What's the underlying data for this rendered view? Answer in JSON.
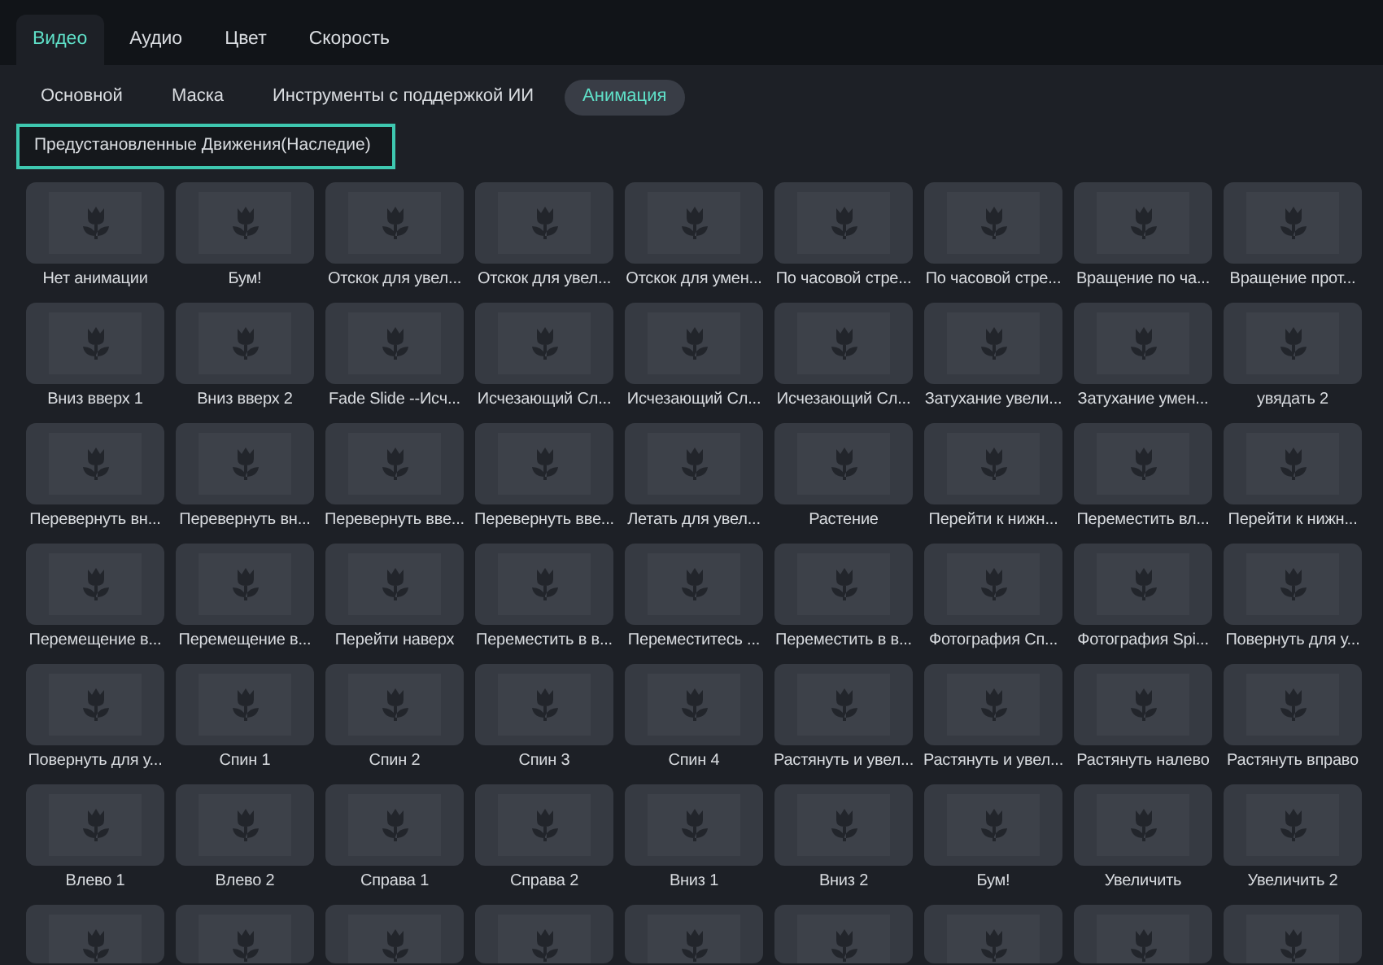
{
  "tabs": [
    {
      "label": "Видео",
      "selected": true
    },
    {
      "label": "Аудио",
      "selected": false
    },
    {
      "label": "Цвет",
      "selected": false
    },
    {
      "label": "Скорость",
      "selected": false
    }
  ],
  "subtabs": [
    {
      "label": "Основной",
      "selected": false
    },
    {
      "label": "Маска",
      "selected": false
    },
    {
      "label": "Инструменты с поддержкой ИИ",
      "selected": false
    },
    {
      "label": "Анимация",
      "selected": true
    }
  ],
  "category": {
    "value": "Предустановленные Движения(Наследие)"
  },
  "presets": [
    {
      "kind": "full",
      "label": "Нет анимации"
    },
    {
      "kind": "full",
      "label": "Бум!"
    },
    {
      "kind": "full",
      "label": "Отскок для увел..."
    },
    {
      "kind": "full",
      "label": "Отскок для увел..."
    },
    {
      "kind": "full",
      "label": "Отскок для умен..."
    },
    {
      "kind": "full",
      "label": "По часовой стре..."
    },
    {
      "kind": "full",
      "label": "По часовой стре..."
    },
    {
      "kind": "full",
      "label": "Вращение по ча..."
    },
    {
      "kind": "full",
      "label": "Вращение прот..."
    },
    {
      "kind": "full",
      "label": "Вниз вверх 1"
    },
    {
      "kind": "full",
      "label": "Вниз вверх 2"
    },
    {
      "kind": "full",
      "label": "Fade Slide --Исч..."
    },
    {
      "kind": "full",
      "label": "Исчезающий Сл..."
    },
    {
      "kind": "full",
      "label": "Исчезающий Сл..."
    },
    {
      "kind": "full",
      "label": "Исчезающий Сл..."
    },
    {
      "kind": "full",
      "label": "Затухание увели..."
    },
    {
      "kind": "full",
      "label": "Затухание умен..."
    },
    {
      "kind": "full",
      "label": "увядать 2"
    },
    {
      "kind": "full",
      "label": "Перевернуть вн..."
    },
    {
      "kind": "full",
      "label": "Перевернуть вн..."
    },
    {
      "kind": "full",
      "label": "Перевернуть вве..."
    },
    {
      "kind": "full",
      "label": "Перевернуть вве..."
    },
    {
      "kind": "full",
      "label": "Летать для увел..."
    },
    {
      "kind": "full",
      "label": "Растение"
    },
    {
      "kind": "full",
      "label": "Перейти к нижн..."
    },
    {
      "kind": "full",
      "label": "Переместить вл..."
    },
    {
      "kind": "full",
      "label": "Перейти к нижн..."
    },
    {
      "kind": "full",
      "label": "Перемещение в..."
    },
    {
      "kind": "full",
      "label": "Перемещение в..."
    },
    {
      "kind": "full",
      "label": "Перейти наверх"
    },
    {
      "kind": "full",
      "label": "Переместить в в..."
    },
    {
      "kind": "full",
      "label": "Переместитесь ..."
    },
    {
      "kind": "full",
      "label": "Переместить в в..."
    },
    {
      "kind": "full",
      "label": "Фотография Сп..."
    },
    {
      "kind": "full",
      "label": "Фотография Spi..."
    },
    {
      "kind": "full",
      "label": "Повернуть для у..."
    },
    {
      "kind": "full",
      "label": "Повернуть для у..."
    },
    {
      "kind": "full",
      "label": "Спин 1"
    },
    {
      "kind": "full",
      "label": "Спин 2"
    },
    {
      "kind": "full",
      "label": "Спин 3"
    },
    {
      "kind": "full",
      "label": "Спин 4"
    },
    {
      "kind": "full",
      "label": "Растянуть и увел..."
    },
    {
      "kind": "full",
      "label": "Растянуть и увел..."
    },
    {
      "kind": "full",
      "label": "Растянуть налево"
    },
    {
      "kind": "full",
      "label": "Растянуть вправо"
    },
    {
      "kind": "full",
      "label": "Влево 1"
    },
    {
      "kind": "full",
      "label": "Влево 2"
    },
    {
      "kind": "full",
      "label": "Справа 1"
    },
    {
      "kind": "full",
      "label": "Справа 2"
    },
    {
      "kind": "full",
      "label": "Вниз 1"
    },
    {
      "kind": "full",
      "label": "Вниз 2"
    },
    {
      "kind": "full",
      "label": "Бум!"
    },
    {
      "kind": "full",
      "label": "Увеличить"
    },
    {
      "kind": "full",
      "label": "Увеличить 2"
    },
    {
      "kind": "partial"
    },
    {
      "kind": "partial"
    },
    {
      "kind": "partial"
    },
    {
      "kind": "partial"
    },
    {
      "kind": "partial"
    },
    {
      "kind": "partial"
    },
    {
      "kind": "partial"
    },
    {
      "kind": "partial"
    },
    {
      "kind": "partial"
    }
  ]
}
